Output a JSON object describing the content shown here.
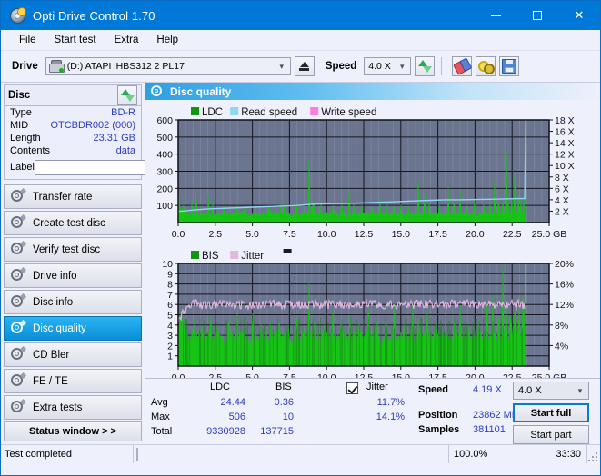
{
  "window": {
    "title": "Opti Drive Control 1.70",
    "icon": "optical-disc-icon",
    "minimize": "minimize",
    "maximize": "maximize",
    "close": "close"
  },
  "menu": {
    "items": [
      "File",
      "Start test",
      "Extra",
      "Help"
    ]
  },
  "toolbar": {
    "drive_label": "Drive",
    "drive_value": "(D:)   ATAPI iHBS312   2 PL17",
    "eject_title": "Eject",
    "speed_label": "Speed",
    "speed_value": "4.0 X",
    "refresh_title": "Refresh",
    "erase_title": "Erase",
    "keys_title": "Keys",
    "save_title": "Save"
  },
  "sidebar": {
    "disc_panel": {
      "title": "Disc",
      "refresh_title": "Refresh disc info",
      "rows": [
        {
          "key": "Type",
          "value": "BD-R"
        },
        {
          "key": "MID",
          "value": "OTCBDR002 (000)"
        },
        {
          "key": "Length",
          "value": "23.31 GB"
        },
        {
          "key": "Contents",
          "value": "data"
        }
      ],
      "label_key": "Label",
      "label_value": "",
      "label_placeholder": "",
      "cd_title": "Disc label"
    },
    "nav": [
      {
        "label": "Transfer rate",
        "active": false
      },
      {
        "label": "Create test disc",
        "active": false
      },
      {
        "label": "Verify test disc",
        "active": false
      },
      {
        "label": "Drive info",
        "active": false
      },
      {
        "label": "Disc info",
        "active": false
      },
      {
        "label": "Disc quality",
        "active": true
      },
      {
        "label": "CD Bler",
        "active": false
      },
      {
        "label": "FE / TE",
        "active": false
      },
      {
        "label": "Extra tests",
        "active": false
      }
    ],
    "status_window_button": "Status window > >"
  },
  "main": {
    "panel_title": "Disc quality",
    "stats": {
      "col_ldc": "LDC",
      "col_bis": "BIS",
      "jitter_label": "Jitter",
      "jitter_checked": true,
      "rows": [
        {
          "name": "Avg",
          "ldc": "24.44",
          "bis": "0.36",
          "jitter": "11.7%"
        },
        {
          "name": "Max",
          "ldc": "506",
          "bis": "10",
          "jitter": "14.1%"
        },
        {
          "name": "Total",
          "ldc": "9330928",
          "bis": "137715",
          "jitter": ""
        }
      ],
      "speed_label": "Speed",
      "speed_value": "4.19 X",
      "position_label": "Position",
      "position_value": "23862 MB",
      "samples_label": "Samples",
      "samples_value": "381101",
      "speed_select": "4.0 X",
      "start_full": "Start full",
      "start_part": "Start part"
    }
  },
  "statusbar": {
    "message": "Test completed",
    "percent_label": "100.0%",
    "percent_value": 100,
    "elapsed": "33:30"
  },
  "colors": {
    "accent": "#0078d7",
    "value_blue": "#2b3dc4",
    "ldc_green": "#15c415",
    "bis_green": "#15c415",
    "read_speed": "#8fd6f5",
    "write_speed": "#ff7ce0",
    "jitter_pink": "#e3b8e0",
    "plot_bg": "#6b7590",
    "progress_green": "#12b512"
  },
  "chart_data": [
    {
      "type": "area",
      "id": "ldc-chart",
      "title": "",
      "legend": [
        "LDC",
        "Read speed",
        "Write speed"
      ],
      "legend_colors": [
        "#119511",
        "#8fd6f5",
        "#ff7ce0"
      ],
      "legend_position": "top-left",
      "xlabel": "GB",
      "ylabel": "LDC",
      "y2label": "X",
      "xlim": [
        0,
        25.0
      ],
      "ylim": [
        0,
        600
      ],
      "y2lim": [
        0,
        18
      ],
      "xticks": [
        0.0,
        2.5,
        5.0,
        7.5,
        10.0,
        12.5,
        15.0,
        17.5,
        20.0,
        22.5,
        25.0
      ],
      "xticklabels": [
        "0.0",
        "2.5",
        "5.0",
        "7.5",
        "10.0",
        "12.5",
        "15.0",
        "17.5",
        "20.0",
        "22.5",
        "25.0 GB"
      ],
      "yticks": [
        100,
        200,
        300,
        400,
        500,
        600
      ],
      "y2ticks": [
        2,
        4,
        6,
        8,
        10,
        12,
        14,
        16,
        18
      ],
      "y2ticklabels": [
        "2 X",
        "4 X",
        "6 X",
        "8 X",
        "10 X",
        "12 X",
        "14 X",
        "16 X",
        "18 X"
      ],
      "grid": true,
      "data_end_gb": 23.4,
      "series": [
        {
          "name": "LDC",
          "color": "#15c415",
          "kind": "spiky-area",
          "baseline": 45,
          "noise": 28,
          "spikes": [
            [
              0.05,
              160
            ],
            [
              0.35,
              110
            ],
            [
              0.9,
              130
            ],
            [
              1.15,
              190
            ],
            [
              1.2,
              150
            ],
            [
              2.0,
              165
            ],
            [
              2.35,
              120
            ],
            [
              3.1,
              105
            ],
            [
              4.0,
              110
            ],
            [
              4.5,
              100
            ],
            [
              5.2,
              95
            ],
            [
              6.1,
              110
            ],
            [
              6.9,
              130
            ],
            [
              7.1,
              120
            ],
            [
              8.0,
              110
            ],
            [
              8.8,
              415
            ],
            [
              9.1,
              120
            ],
            [
              9.6,
              115
            ],
            [
              10.4,
              110
            ],
            [
              11.0,
              105
            ],
            [
              11.5,
              190
            ],
            [
              11.8,
              120
            ],
            [
              12.4,
              110
            ],
            [
              13.1,
              100
            ],
            [
              13.6,
              160
            ],
            [
              14.1,
              120
            ],
            [
              14.6,
              110
            ],
            [
              15.0,
              110
            ],
            [
              15.5,
              105
            ],
            [
              16.2,
              290
            ],
            [
              16.6,
              170
            ],
            [
              16.9,
              120
            ],
            [
              17.6,
              120
            ],
            [
              18.2,
              215
            ],
            [
              18.6,
              110
            ],
            [
              19.0,
              205
            ],
            [
              19.4,
              110
            ],
            [
              20.0,
              155
            ],
            [
              20.6,
              115
            ],
            [
              21.0,
              120
            ],
            [
              21.3,
              290
            ],
            [
              21.6,
              120
            ],
            [
              21.9,
              130
            ],
            [
              22.1,
              470
            ],
            [
              22.25,
              140
            ],
            [
              22.5,
              150
            ],
            [
              22.7,
              290
            ],
            [
              22.9,
              170
            ],
            [
              23.1,
              140
            ],
            [
              23.3,
              160
            ]
          ]
        },
        {
          "name": "Read speed",
          "color": "#8fd6f5",
          "kind": "step-line",
          "points": [
            [
              0.0,
              2.0
            ],
            [
              0.3,
              2.0
            ],
            [
              1.0,
              2.2
            ],
            [
              2.0,
              2.4
            ],
            [
              3.0,
              2.5
            ],
            [
              4.0,
              2.6
            ],
            [
              5.0,
              2.7
            ],
            [
              6.0,
              2.8
            ],
            [
              7.0,
              2.9
            ],
            [
              8.0,
              3.0
            ],
            [
              9.0,
              3.2
            ],
            [
              10.0,
              3.3
            ],
            [
              11.0,
              3.35
            ],
            [
              12.0,
              3.4
            ],
            [
              13.0,
              3.5
            ],
            [
              14.0,
              3.6
            ],
            [
              15.0,
              3.7
            ],
            [
              16.0,
              3.8
            ],
            [
              17.0,
              3.9
            ],
            [
              18.0,
              4.0
            ],
            [
              19.0,
              4.0
            ],
            [
              20.0,
              4.05
            ],
            [
              21.0,
              4.1
            ],
            [
              22.0,
              4.15
            ],
            [
              23.0,
              4.2
            ],
            [
              23.35,
              4.2
            ],
            [
              23.42,
              18.0
            ]
          ]
        }
      ]
    },
    {
      "type": "area",
      "id": "bis-jitter-chart",
      "title": "",
      "legend": [
        "BIS",
        "Jitter"
      ],
      "legend_colors": [
        "#119511",
        "#e3b8e0"
      ],
      "legend_position": "top-left",
      "xlabel": "GB",
      "ylabel": "BIS",
      "y2label": "%",
      "xlim": [
        0,
        25.0
      ],
      "ylim": [
        0,
        10
      ],
      "y2lim": [
        0,
        20
      ],
      "xticks": [
        0.0,
        2.5,
        5.0,
        7.5,
        10.0,
        12.5,
        15.0,
        17.5,
        20.0,
        22.5,
        25.0
      ],
      "xticklabels": [
        "0.0",
        "2.5",
        "5.0",
        "7.5",
        "10.0",
        "12.5",
        "15.0",
        "17.5",
        "20.0",
        "22.5",
        "25.0 GB"
      ],
      "yticks": [
        1,
        2,
        3,
        4,
        5,
        6,
        7,
        8,
        9,
        10
      ],
      "y2ticks": [
        4,
        8,
        12,
        16,
        20
      ],
      "y2ticklabels": [
        "4%",
        "8%",
        "12%",
        "16%",
        "20%"
      ],
      "grid": true,
      "data_end_gb": 23.4,
      "series": [
        {
          "name": "BIS",
          "color": "#15c415",
          "kind": "spiky-area",
          "baseline": 2.6,
          "noise": 1.4,
          "spikes": [
            [
              0.1,
              5.0
            ],
            [
              0.5,
              4.4
            ],
            [
              1.1,
              5.0
            ],
            [
              1.6,
              4.3
            ],
            [
              2.2,
              5.2
            ],
            [
              2.6,
              4.2
            ],
            [
              3.4,
              4.4
            ],
            [
              4.0,
              5.1
            ],
            [
              4.4,
              4.2
            ],
            [
              5.0,
              5.2
            ],
            [
              5.6,
              4.4
            ],
            [
              6.2,
              4.3
            ],
            [
              6.8,
              5.0
            ],
            [
              7.4,
              4.4
            ],
            [
              8.0,
              5.2
            ],
            [
              8.8,
              9.1
            ],
            [
              9.2,
              4.5
            ],
            [
              9.8,
              4.3
            ],
            [
              10.4,
              5.4
            ],
            [
              11.0,
              4.4
            ],
            [
              11.6,
              5.0
            ],
            [
              12.2,
              4.3
            ],
            [
              12.8,
              6.3
            ],
            [
              13.4,
              4.4
            ],
            [
              14.0,
              5.0
            ],
            [
              14.6,
              6.2
            ],
            [
              15.2,
              4.4
            ],
            [
              15.8,
              6.4
            ],
            [
              16.2,
              5.0
            ],
            [
              16.8,
              5.6
            ],
            [
              17.4,
              4.6
            ],
            [
              18.0,
              6.4
            ],
            [
              18.6,
              4.6
            ],
            [
              19.0,
              6.2
            ],
            [
              19.6,
              4.6
            ],
            [
              20.2,
              5.0
            ],
            [
              20.8,
              5.8
            ],
            [
              21.2,
              8.0
            ],
            [
              21.6,
              5.2
            ],
            [
              21.9,
              10.0
            ],
            [
              22.1,
              6.0
            ],
            [
              22.4,
              5.2
            ],
            [
              22.7,
              6.0
            ],
            [
              23.0,
              6.4
            ],
            [
              23.25,
              6.8
            ]
          ]
        },
        {
          "name": "Jitter",
          "color": "#e3b8e0",
          "kind": "noisy-line",
          "baseline": 6.0,
          "noise": 0.45,
          "ramp_from": 4.6,
          "ramp_to_gb": 1.0
        }
      ]
    }
  ]
}
